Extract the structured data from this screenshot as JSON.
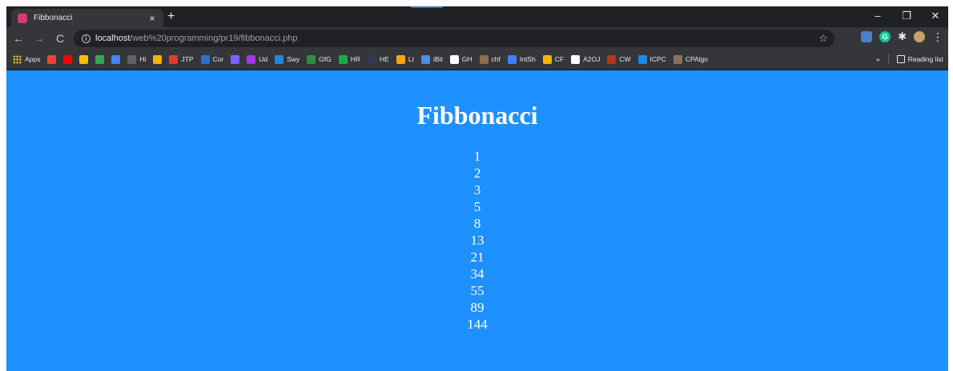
{
  "browser": {
    "tab": {
      "title": "Fibbonacci",
      "close_glyph": "×",
      "favicon_color": "#d93a76"
    },
    "new_tab_glyph": "+",
    "window_controls": [
      "–",
      "❐",
      "✕"
    ],
    "url": {
      "host": "localhost",
      "path": "/web%20programming/pr19/fibbonacci.php"
    },
    "bookmarks": [
      {
        "label": "Apps",
        "icon": "apps-grid-icon",
        "color": "#e8b73a"
      },
      {
        "label": "",
        "icon": "gmail-icon",
        "color": "#ea4335"
      },
      {
        "label": "",
        "icon": "youtube-icon",
        "color": "#ff0000"
      },
      {
        "label": "",
        "icon": "drive-icon",
        "color": "#fbbc04"
      },
      {
        "label": "",
        "icon": "maps-icon",
        "color": "#34a853"
      },
      {
        "label": "",
        "icon": "translate-icon",
        "color": "#4285f4"
      },
      {
        "label": "Hi",
        "icon": "hi-icon",
        "color": "#5f6368"
      },
      {
        "label": "",
        "icon": "coffee-icon",
        "color": "#f4b400"
      },
      {
        "label": "JTP",
        "icon": "jtp-icon",
        "color": "#e53935"
      },
      {
        "label": "Cor",
        "icon": "coursera-icon",
        "color": "#2a73cc"
      },
      {
        "label": "",
        "icon": "star-bookmark-icon",
        "color": "#7b61ff"
      },
      {
        "label": "Ud",
        "icon": "udemy-icon",
        "color": "#a435f0"
      },
      {
        "label": "Swy",
        "icon": "swayam-icon",
        "color": "#1e88e5"
      },
      {
        "label": "GfG",
        "icon": "gfg-icon",
        "color": "#2f8d46"
      },
      {
        "label": "HR",
        "icon": "hackerrank-icon",
        "color": "#1ba94c"
      },
      {
        "label": "HE",
        "icon": "hackerearth-icon",
        "color": "#323754"
      },
      {
        "label": "Lt",
        "icon": "leetcode-icon",
        "color": "#ffa116"
      },
      {
        "label": "iBit",
        "icon": "interviewbit-icon",
        "color": "#4a90e2"
      },
      {
        "label": "GH",
        "icon": "github-icon",
        "color": "#ffffff"
      },
      {
        "label": "chf",
        "icon": "codechef-icon",
        "color": "#8b6e4e"
      },
      {
        "label": "IntSh",
        "icon": "interviewshell-icon",
        "color": "#3b82f6"
      },
      {
        "label": "CF",
        "icon": "codeforces-icon",
        "color": "#f4b400"
      },
      {
        "label": "A2OJ",
        "icon": "a2oj-icon",
        "color": "#ffffff"
      },
      {
        "label": "CW",
        "icon": "codewars-icon",
        "color": "#b1361e"
      },
      {
        "label": "ICPC",
        "icon": "icpc-icon",
        "color": "#1e88e5"
      },
      {
        "label": "CPAlgo",
        "icon": "cpalgo-icon",
        "color": "#8d6e63"
      }
    ],
    "overflow_glyph": "»",
    "reading_list_label": "Reading list"
  },
  "page": {
    "background": "#1e90ff",
    "heading": "Fibbonacci",
    "sequence": [
      "1",
      "2",
      "3",
      "5",
      "8",
      "13",
      "21",
      "34",
      "55",
      "89",
      "144"
    ]
  }
}
